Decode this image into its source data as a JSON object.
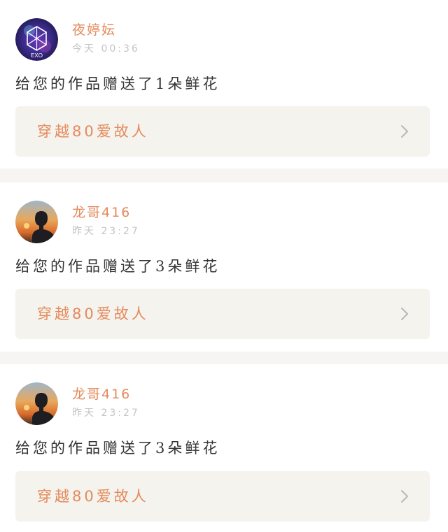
{
  "feed": {
    "items": [
      {
        "user": "夜婷妘",
        "avatar": "exo-logo-avatar",
        "time": "今天  00:36",
        "message": "给您的作品赠送了1朵鲜花",
        "work_title": "穿越80爱故人",
        "chevron_icon": "chevron-right-icon"
      },
      {
        "user": "龙哥416",
        "avatar": "sunset-silhouette-avatar",
        "time": "昨天  23:27",
        "message": "给您的作品赠送了3朵鲜花",
        "work_title": "穿越80爱故人",
        "chevron_icon": "chevron-right-icon"
      },
      {
        "user": "龙哥416",
        "avatar": "sunset-silhouette-avatar",
        "time": "昨天  23:27",
        "message": "给您的作品赠送了3朵鲜花",
        "work_title": "穿越80爱故人",
        "chevron_icon": "chevron-right-icon"
      }
    ]
  },
  "colors": {
    "accent": "#e58a5c",
    "timestamp": "#c4c4c4",
    "link_background": "#f4f3ee",
    "separator": "#f6f5f3"
  }
}
